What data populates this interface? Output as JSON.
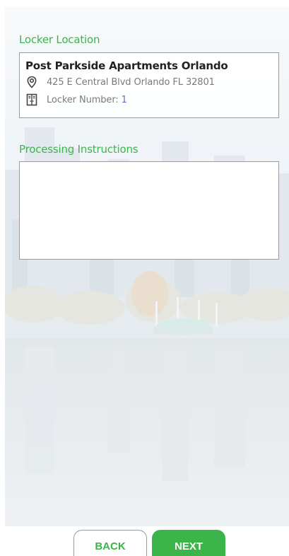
{
  "locker_section": {
    "title": "Locker Location",
    "location_name": "Post Parkside Apartments Orlando",
    "address": "425 E Central Blvd Orlando FL 32801",
    "locker_number_label": "Locker Number:",
    "locker_number": "1"
  },
  "instructions_section": {
    "title": "Processing Instructions",
    "value": "",
    "placeholder": ""
  },
  "footer": {
    "back_label": "BACK",
    "next_label": "NEXT"
  },
  "icons": {
    "address": "map-pin-icon",
    "locker": "locker-icon"
  },
  "colors": {
    "accent": "#3bb54a",
    "locker_number": "#5b6fd6"
  }
}
